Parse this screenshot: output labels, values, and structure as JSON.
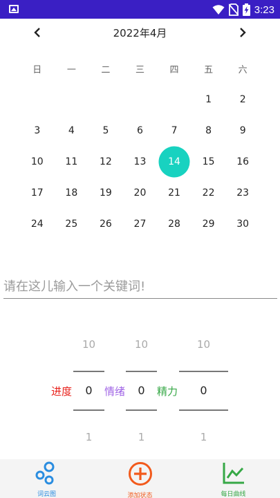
{
  "status_bar": {
    "time": "3:23"
  },
  "calendar": {
    "title": "2022年4月",
    "weekdays": [
      "日",
      "一",
      "二",
      "三",
      "四",
      "五",
      "六"
    ],
    "weeks": [
      [
        "",
        "",
        "",
        "",
        "",
        "1",
        "2"
      ],
      [
        "3",
        "4",
        "5",
        "6",
        "7",
        "8",
        "9"
      ],
      [
        "10",
        "11",
        "12",
        "13",
        "14",
        "15",
        "16"
      ],
      [
        "17",
        "18",
        "19",
        "20",
        "21",
        "22",
        "23"
      ],
      [
        "24",
        "25",
        "26",
        "27",
        "28",
        "29",
        "30"
      ]
    ],
    "selected_day": "14",
    "selected_color": "#18d2c0"
  },
  "keyword": {
    "placeholder": "请在这儿输入一个关键词!",
    "value": ""
  },
  "pickers": [
    {
      "label": "进度",
      "label_color": "#e8221c",
      "above": "10",
      "value": "0",
      "below": "1"
    },
    {
      "label": "情绪",
      "label_color": "#a166e6",
      "above": "10",
      "value": "0",
      "below": "1"
    },
    {
      "label": "精力",
      "label_color": "#36a846",
      "above": "10",
      "value": "0",
      "below": "1"
    }
  ],
  "bottom_nav": [
    {
      "label": "词云图",
      "color": "#2a8de0",
      "icon": "bubbles-icon"
    },
    {
      "label": "添加状态",
      "color": "#f25a1c",
      "icon": "add-circle-icon"
    },
    {
      "label": "每日曲线",
      "color": "#36a846",
      "icon": "line-chart-icon"
    }
  ]
}
